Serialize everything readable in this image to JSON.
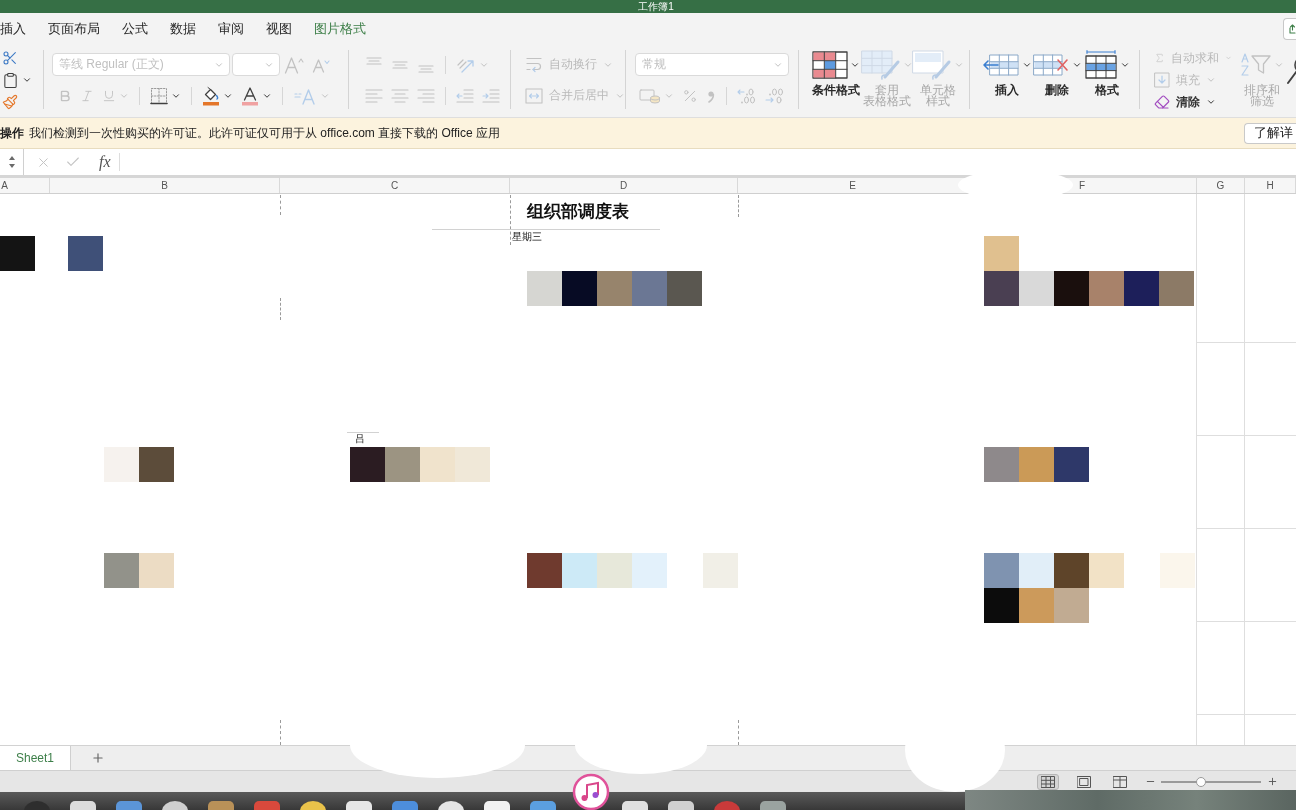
{
  "window": {
    "title": "工作簿1"
  },
  "ribbon_tabs": [
    {
      "label": "插入",
      "selected": false
    },
    {
      "label": "页面布局",
      "selected": false
    },
    {
      "label": "公式",
      "selected": false
    },
    {
      "label": "数据",
      "selected": false
    },
    {
      "label": "审阅",
      "selected": false
    },
    {
      "label": "视图",
      "selected": false
    },
    {
      "label": "图片格式",
      "selected": true
    }
  ],
  "ribbon": {
    "clipboard": [
      {
        "kind": "cut",
        "disabled": false
      },
      {
        "kind": "paste",
        "disabled": false
      },
      {
        "kind": "format_painter",
        "disabled": false
      }
    ],
    "font": {
      "font_name": {
        "value": "等线 Regular (正文)",
        "disabled": true
      },
      "font_size": {
        "disabled": true
      },
      "top_tools": [
        {
          "kind": "grow_font",
          "disabled": true
        },
        {
          "kind": "shrink_font",
          "disabled": true
        }
      ],
      "bottom_tools": [
        {
          "kind": "bold",
          "disabled": true
        },
        {
          "kind": "italic",
          "disabled": true
        },
        {
          "kind": "underline",
          "disabled": true
        },
        {
          "kind": "borders",
          "disabled": false
        },
        {
          "kind": "fill_color",
          "disabled": false
        },
        {
          "kind": "font_color",
          "disabled": false
        },
        {
          "kind": "text_effects",
          "disabled": true
        }
      ]
    },
    "alignment": {
      "top_tools": [
        {
          "kind": "align_top",
          "disabled": true
        },
        {
          "kind": "align_middle",
          "disabled": true
        },
        {
          "kind": "align_bottom",
          "disabled": true
        },
        {
          "kind": "orientation",
          "disabled": true
        }
      ],
      "bottom_tools": [
        {
          "kind": "align_left",
          "disabled": true
        },
        {
          "kind": "align_center",
          "disabled": true
        },
        {
          "kind": "align_right",
          "disabled": true
        },
        {
          "kind": "indent_decrease",
          "disabled": true
        },
        {
          "kind": "indent_increase",
          "disabled": true
        }
      ]
    },
    "wrap_merge": [
      {
        "kind": "wrap_text",
        "label": "自动换行",
        "disabled": true
      },
      {
        "kind": "merge_center",
        "label": "合并后居中",
        "disabled": true
      }
    ],
    "number": {
      "format": {
        "value": "常规",
        "disabled": true
      },
      "tools": [
        {
          "kind": "accounting",
          "disabled": true
        },
        {
          "kind": "percent",
          "disabled": true
        },
        {
          "kind": "comma",
          "disabled": true
        },
        {
          "kind": "increase_decimal",
          "disabled": true
        },
        {
          "kind": "decrease_decimal",
          "disabled": true
        }
      ]
    },
    "styles": [
      {
        "kind": "conditional_format",
        "lines": [
          "条件格式"
        ],
        "disabled": false
      },
      {
        "kind": "table_format",
        "lines": [
          "套用",
          "表格格式"
        ],
        "disabled": true
      },
      {
        "kind": "cell_styles",
        "lines": [
          "单元格",
          "样式"
        ],
        "disabled": true
      }
    ],
    "cells": [
      {
        "kind": "insert",
        "lines": [
          "插入"
        ],
        "disabled": false
      },
      {
        "kind": "delete",
        "lines": [
          "删除"
        ],
        "disabled": false
      },
      {
        "kind": "format",
        "lines": [
          "格式"
        ],
        "disabled": false
      }
    ],
    "editing": [
      {
        "kind": "autosum",
        "label": "自动求和",
        "disabled": true
      },
      {
        "kind": "fill",
        "label": "填充",
        "disabled": true
      },
      {
        "kind": "clear",
        "label": "清除",
        "disabled": false
      }
    ],
    "sort_filter": {
      "kind": "sort_filter",
      "lines": [
        "排序和",
        "筛选"
      ],
      "disabled": true
    }
  },
  "notice": {
    "title": "操作",
    "message": "我们检测到一次性购买的许可证。此许可证仅可用于从 office.com 直接下载的 Office 应用",
    "button": "了解详"
  },
  "formula_bar": {
    "function_label": "fx",
    "editing": false
  },
  "columns": [
    "A",
    "B",
    "C",
    "D",
    "E",
    "F",
    "G",
    "H"
  ],
  "sheet": {
    "cells": [
      {
        "kind": "title",
        "text": "组织部调度表"
      },
      {
        "kind": "note",
        "text": "星期三"
      },
      {
        "kind": "note",
        "text": "吕"
      }
    ]
  },
  "sheet_tabs": [
    {
      "label": "Sheet1",
      "selected": true
    }
  ],
  "status_bar": {
    "views": [
      {
        "kind": "normal",
        "selected": true
      },
      {
        "kind": "page_layout",
        "selected": false
      },
      {
        "kind": "page_break",
        "selected": false
      }
    ],
    "zoom": {
      "level": 0.4
    }
  }
}
